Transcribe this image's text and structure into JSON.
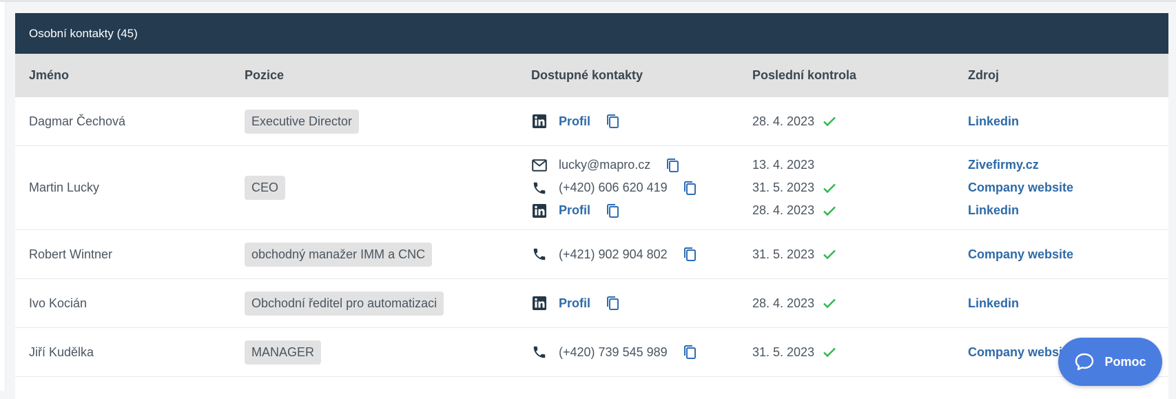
{
  "panel": {
    "title": "Osobní kontakty (45)"
  },
  "columns": {
    "name": "Jméno",
    "position": "Pozice",
    "contacts": "Dostupné kontakty",
    "last_check": "Poslední kontrola",
    "source": "Zdroj"
  },
  "rows": [
    {
      "name": "Dagmar Čechová",
      "position": "Executive Director",
      "contacts": [
        {
          "icon": "linkedin-icon",
          "value": "Profil"
        }
      ],
      "checks": [
        {
          "date": "28. 4. 2023",
          "verified": true
        }
      ],
      "sources": [
        "Linkedin"
      ]
    },
    {
      "name": "Martin Lucky",
      "position": "CEO",
      "contacts": [
        {
          "icon": "email-icon",
          "value": "lucky@mapro.cz"
        },
        {
          "icon": "phone-icon",
          "value": "(+420) 606 620 419"
        },
        {
          "icon": "linkedin-icon",
          "value": "Profil"
        }
      ],
      "checks": [
        {
          "date": "13. 4. 2023",
          "verified": false
        },
        {
          "date": "31. 5. 2023",
          "verified": true
        },
        {
          "date": "28. 4. 2023",
          "verified": true
        }
      ],
      "sources": [
        "Zivefirmy.cz",
        "Company website",
        "Linkedin"
      ]
    },
    {
      "name": "Robert Wintner",
      "position": "obchodný manažer IMM a CNC",
      "contacts": [
        {
          "icon": "phone-icon",
          "value": "(+421) 902 904 802"
        }
      ],
      "checks": [
        {
          "date": "31. 5. 2023",
          "verified": true
        }
      ],
      "sources": [
        "Company website"
      ]
    },
    {
      "name": "Ivo Kocián",
      "position": "Obchodní ředitel pro automatizaci",
      "contacts": [
        {
          "icon": "linkedin-icon",
          "value": "Profil"
        }
      ],
      "checks": [
        {
          "date": "28. 4. 2023",
          "verified": true
        }
      ],
      "sources": [
        "Linkedin"
      ]
    },
    {
      "name": "Jiří Kudělka",
      "position": "MANAGER",
      "contacts": [
        {
          "icon": "phone-icon",
          "value": "(+420) 739 545 989"
        }
      ],
      "checks": [
        {
          "date": "31. 5. 2023",
          "verified": true
        }
      ],
      "sources": [
        "Company website"
      ]
    }
  ],
  "help": {
    "label": "Pomoc"
  },
  "colors": {
    "header_bg": "#243b50",
    "thead_bg": "#e2e2e2",
    "link": "#2e6aa8",
    "check": "#2db84d",
    "help_bg": "#4a7de0"
  }
}
